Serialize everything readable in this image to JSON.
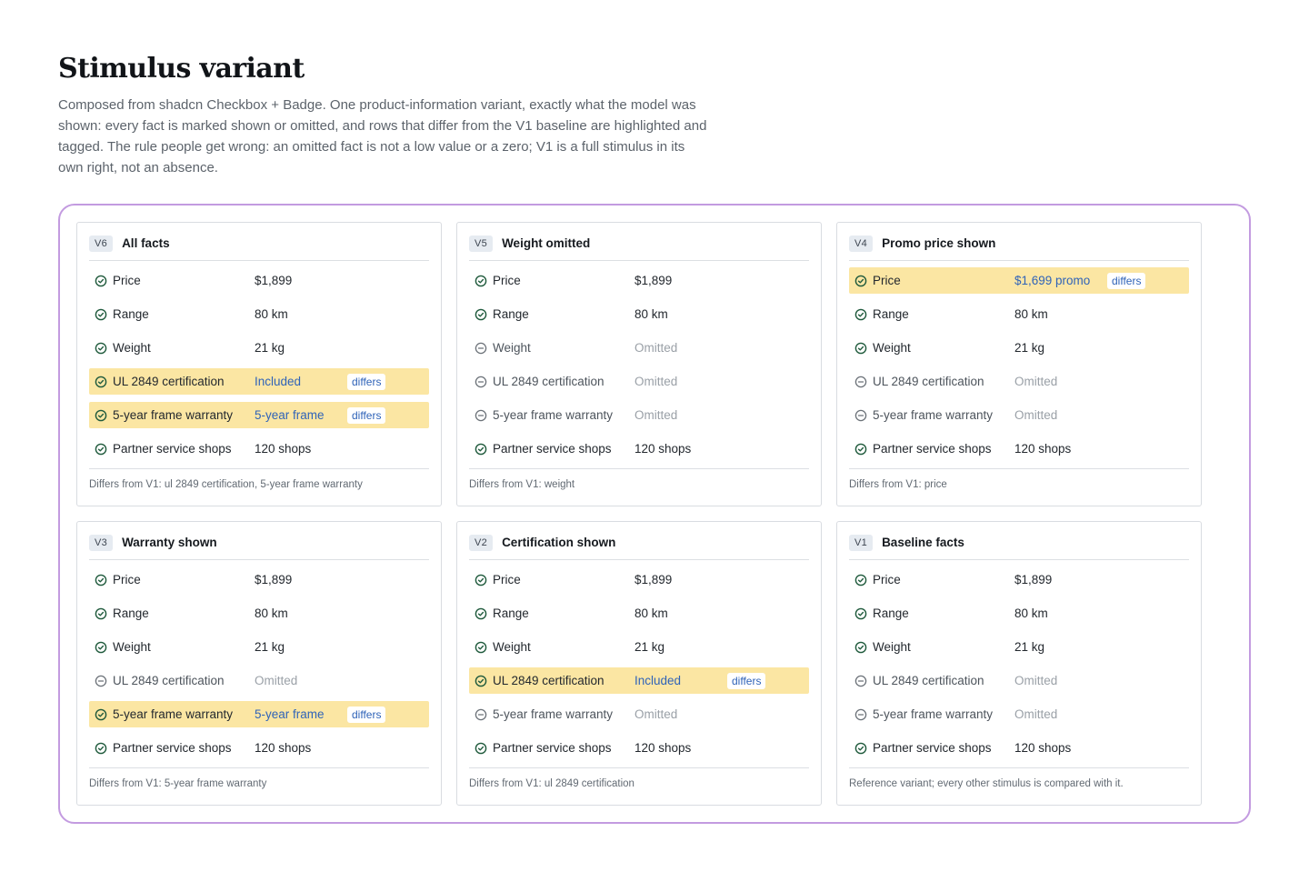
{
  "header": {
    "title": "Stimulus variant",
    "description": "Composed from shadcn Checkbox + Badge. One product-information variant, exactly what the model was shown: every fact is marked shown or omitted, and rows that differ from the V1 baseline are highlighted and tagged. The rule people get wrong: an omitted fact is not a low value or a zero; V1 is a full stimulus in its own right, not an absence."
  },
  "colors": {
    "highlight": "#fbe6a3",
    "frame_border": "#c39be0",
    "shown_icon": "#1f5a3c",
    "omitted_icon": "#6b7178",
    "differs_text": "#2f63b8"
  },
  "icons": {
    "shown": "check-circle-icon",
    "omitted": "minus-circle-icon"
  },
  "differs_label": "differs",
  "variants": [
    {
      "badge": "V6",
      "title": "All facts",
      "rows": [
        {
          "label": "Price",
          "value": "$1,899",
          "shown": true,
          "differs": false
        },
        {
          "label": "Range",
          "value": "80 km",
          "shown": true,
          "differs": false
        },
        {
          "label": "Weight",
          "value": "21 kg",
          "shown": true,
          "differs": false
        },
        {
          "label": "UL 2849 certification",
          "value": "Included",
          "shown": true,
          "differs": true
        },
        {
          "label": "5-year frame warranty",
          "value": "5-year frame",
          "shown": true,
          "differs": true
        },
        {
          "label": "Partner service shops",
          "value": "120 shops",
          "shown": true,
          "differs": false
        }
      ],
      "footer": "Differs from V1: ul 2849 certification, 5-year frame warranty"
    },
    {
      "badge": "V5",
      "title": "Weight omitted",
      "rows": [
        {
          "label": "Price",
          "value": "$1,899",
          "shown": true,
          "differs": false
        },
        {
          "label": "Range",
          "value": "80 km",
          "shown": true,
          "differs": false
        },
        {
          "label": "Weight",
          "value": "Omitted",
          "shown": false,
          "differs": false
        },
        {
          "label": "UL 2849 certification",
          "value": "Omitted",
          "shown": false,
          "differs": false
        },
        {
          "label": "5-year frame warranty",
          "value": "Omitted",
          "shown": false,
          "differs": false
        },
        {
          "label": "Partner service shops",
          "value": "120 shops",
          "shown": true,
          "differs": false
        }
      ],
      "footer": "Differs from V1: weight"
    },
    {
      "badge": "V4",
      "title": "Promo price shown",
      "rows": [
        {
          "label": "Price",
          "value": "$1,699 promo",
          "shown": true,
          "differs": true
        },
        {
          "label": "Range",
          "value": "80 km",
          "shown": true,
          "differs": false
        },
        {
          "label": "Weight",
          "value": "21 kg",
          "shown": true,
          "differs": false
        },
        {
          "label": "UL 2849 certification",
          "value": "Omitted",
          "shown": false,
          "differs": false
        },
        {
          "label": "5-year frame warranty",
          "value": "Omitted",
          "shown": false,
          "differs": false
        },
        {
          "label": "Partner service shops",
          "value": "120 shops",
          "shown": true,
          "differs": false
        }
      ],
      "footer": "Differs from V1: price"
    },
    {
      "badge": "V3",
      "title": "Warranty shown",
      "rows": [
        {
          "label": "Price",
          "value": "$1,899",
          "shown": true,
          "differs": false
        },
        {
          "label": "Range",
          "value": "80 km",
          "shown": true,
          "differs": false
        },
        {
          "label": "Weight",
          "value": "21 kg",
          "shown": true,
          "differs": false
        },
        {
          "label": "UL 2849 certification",
          "value": "Omitted",
          "shown": false,
          "differs": false
        },
        {
          "label": "5-year frame warranty",
          "value": "5-year frame",
          "shown": true,
          "differs": true
        },
        {
          "label": "Partner service shops",
          "value": "120 shops",
          "shown": true,
          "differs": false
        }
      ],
      "footer": "Differs from V1: 5-year frame warranty"
    },
    {
      "badge": "V2",
      "title": "Certification shown",
      "rows": [
        {
          "label": "Price",
          "value": "$1,899",
          "shown": true,
          "differs": false
        },
        {
          "label": "Range",
          "value": "80 km",
          "shown": true,
          "differs": false
        },
        {
          "label": "Weight",
          "value": "21 kg",
          "shown": true,
          "differs": false
        },
        {
          "label": "UL 2849 certification",
          "value": "Included",
          "shown": true,
          "differs": true
        },
        {
          "label": "5-year frame warranty",
          "value": "Omitted",
          "shown": false,
          "differs": false
        },
        {
          "label": "Partner service shops",
          "value": "120 shops",
          "shown": true,
          "differs": false
        }
      ],
      "footer": "Differs from V1: ul 2849 certification"
    },
    {
      "badge": "V1",
      "title": "Baseline facts",
      "rows": [
        {
          "label": "Price",
          "value": "$1,899",
          "shown": true,
          "differs": false
        },
        {
          "label": "Range",
          "value": "80 km",
          "shown": true,
          "differs": false
        },
        {
          "label": "Weight",
          "value": "21 kg",
          "shown": true,
          "differs": false
        },
        {
          "label": "UL 2849 certification",
          "value": "Omitted",
          "shown": false,
          "differs": false
        },
        {
          "label": "5-year frame warranty",
          "value": "Omitted",
          "shown": false,
          "differs": false
        },
        {
          "label": "Partner service shops",
          "value": "120 shops",
          "shown": true,
          "differs": false
        }
      ],
      "footer": "Reference variant; every other stimulus is compared with it."
    }
  ]
}
